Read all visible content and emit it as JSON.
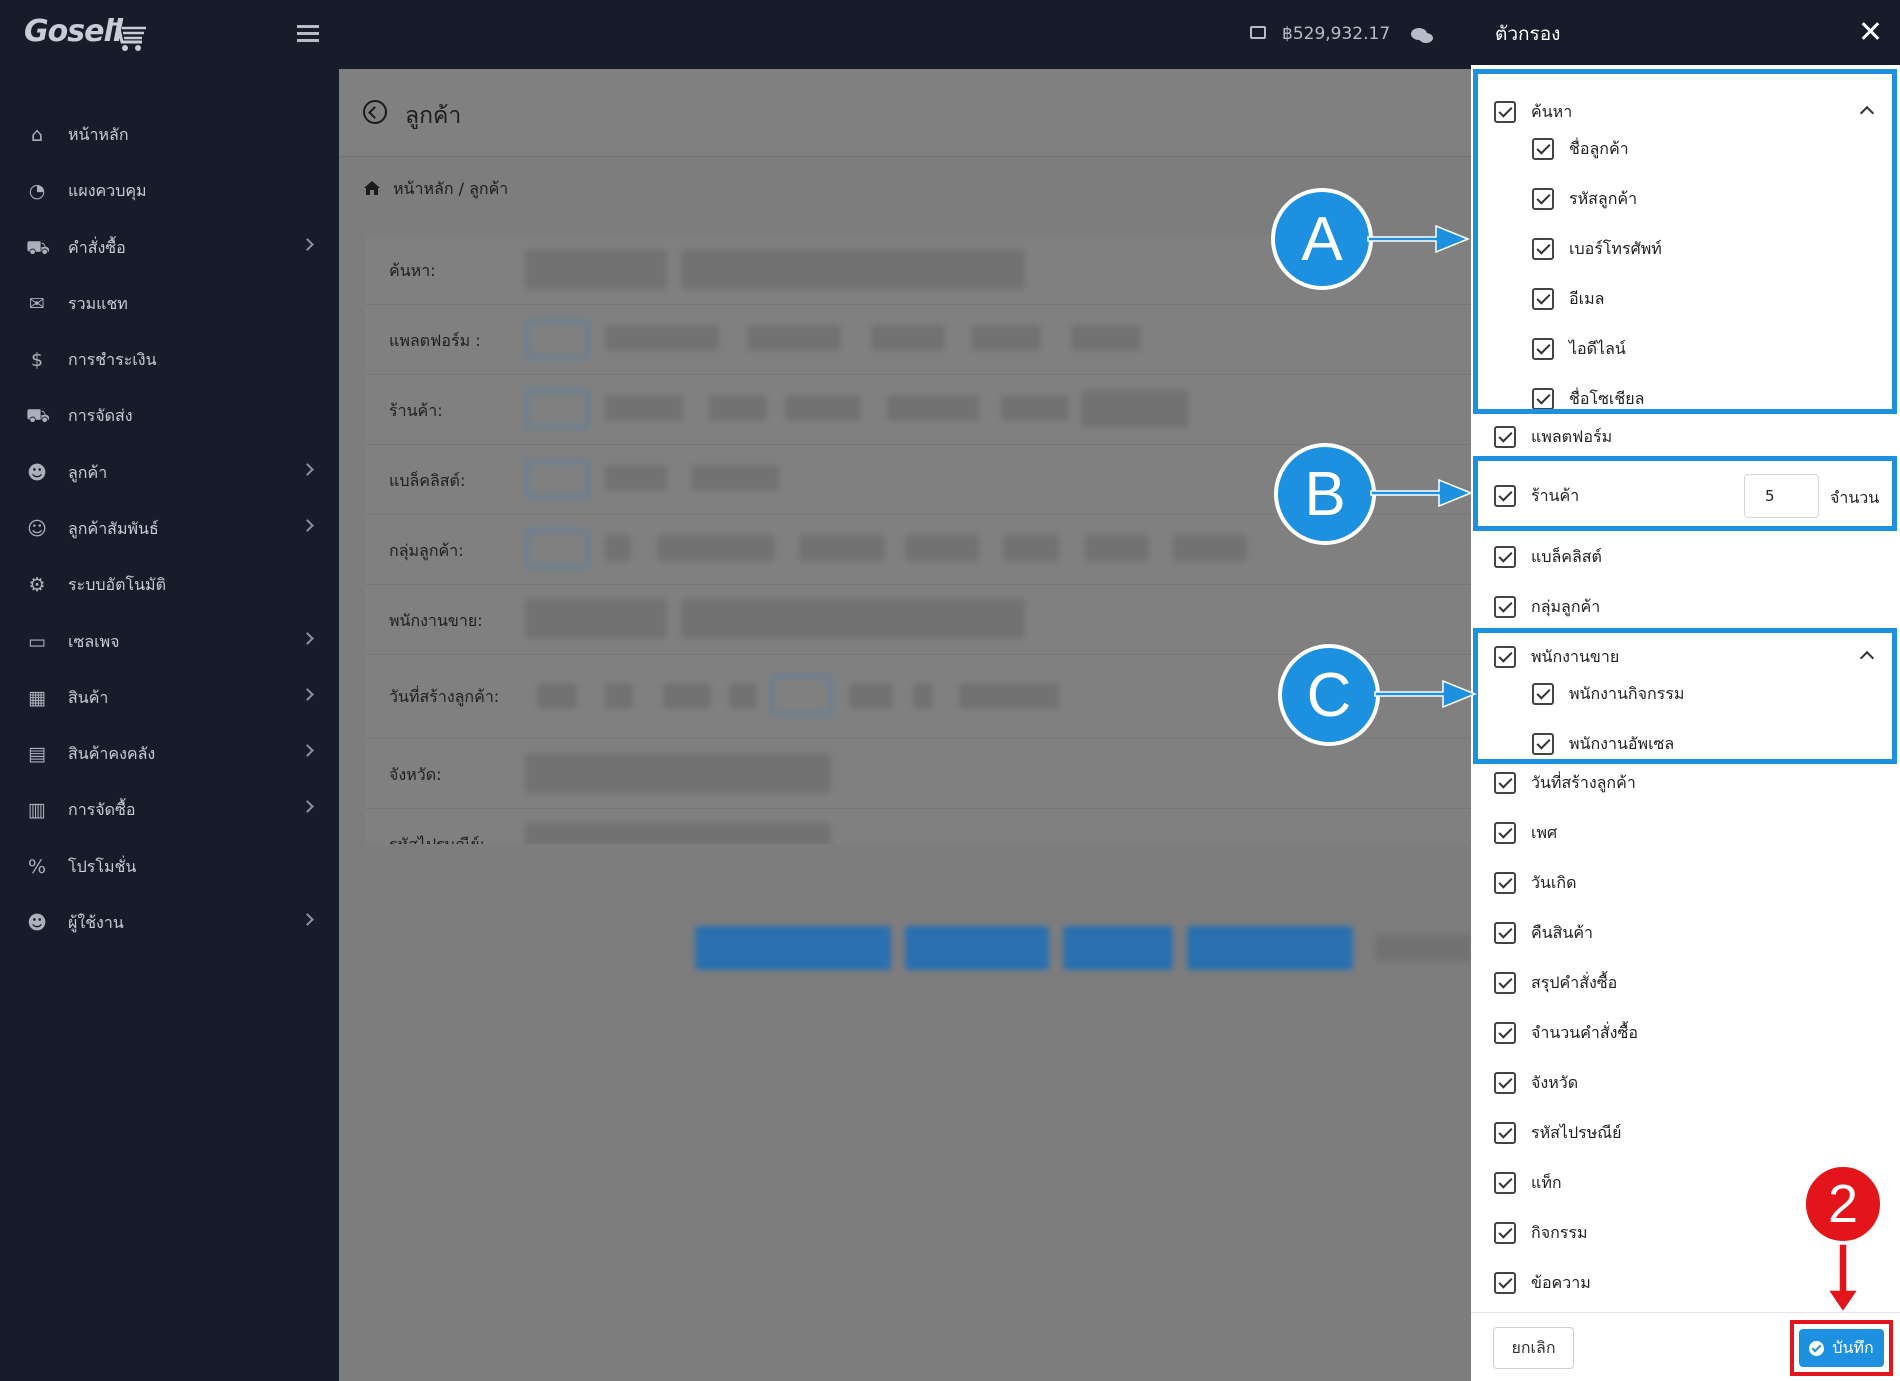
{
  "app": {
    "logo_text": "Gosell",
    "balance": "฿529,932.17"
  },
  "sidebar": {
    "items": [
      {
        "label": "หน้าหลัก",
        "icon": "home-icon",
        "glyph": "⌂",
        "has_children": false
      },
      {
        "label": "แผงควบคุม",
        "icon": "dashboard-icon",
        "glyph": "◔",
        "has_children": false
      },
      {
        "label": "คำสั่งซื้อ",
        "icon": "cart-icon",
        "glyph": "⛟",
        "has_children": true
      },
      {
        "label": "รวมแชท",
        "icon": "chat-icon",
        "glyph": "✉",
        "has_children": false
      },
      {
        "label": "การชำระเงิน",
        "icon": "money-bag-icon",
        "glyph": "$",
        "has_children": false
      },
      {
        "label": "การจัดส่ง",
        "icon": "truck-icon",
        "glyph": "⛟",
        "has_children": false
      },
      {
        "label": "ลูกค้า",
        "icon": "users-icon",
        "glyph": "☻",
        "has_children": true
      },
      {
        "label": "ลูกค้าสัมพันธ์",
        "icon": "user-tie-icon",
        "glyph": "☺",
        "has_children": true
      },
      {
        "label": "ระบบอัตโนมัติ",
        "icon": "robot-icon",
        "glyph": "⚙",
        "has_children": false
      },
      {
        "label": "เซลเพจ",
        "icon": "window-icon",
        "glyph": "▭",
        "has_children": true
      },
      {
        "label": "สินค้า",
        "icon": "boxes-icon",
        "glyph": "▦",
        "has_children": true
      },
      {
        "label": "สินค้าคงคลัง",
        "icon": "warehouse-icon",
        "glyph": "▤",
        "has_children": true
      },
      {
        "label": "การจัดซื้อ",
        "icon": "dolly-icon",
        "glyph": "▥",
        "has_children": true
      },
      {
        "label": "โปรโมชั่น",
        "icon": "percent-icon",
        "glyph": "%",
        "has_children": false
      },
      {
        "label": "ผู้ใช้งาน",
        "icon": "users-cog-icon",
        "glyph": "☻",
        "has_children": true
      }
    ]
  },
  "main": {
    "title": "ลูกค้า",
    "breadcrumb": "หน้าหลัก / ลูกค้า",
    "filter_labels": [
      "ค้นหา:",
      "แพลตฟอร์ม :",
      "ร้านค้า:",
      "แบล็คลิสต์:",
      "กลุ่มลูกค้า:",
      "พนักงานขาย:",
      "วันที่สร้างลูกค้า:",
      "จังหวัด:",
      "รหัสไปรษณีย์:"
    ]
  },
  "panel": {
    "title": "ตัวกรอง",
    "search_group": {
      "label": "ค้นหา",
      "children": [
        "ชื่อลูกค้า",
        "รหัสลูกค้า",
        "เบอร์โทรศัพท์",
        "อีเมล",
        "ไอดีไลน์",
        "ชื่อโซเชียล"
      ]
    },
    "platform_label": "แพลตฟอร์ม",
    "store": {
      "label": "ร้านค้า",
      "count": "5",
      "unit": "จำนวน"
    },
    "blacklist_label": "แบล็คลิสต์",
    "customer_group_label": "กลุ่มลูกค้า",
    "sales_group": {
      "label": "พนักงานขาย",
      "children": [
        "พนักงานกิจกรรม",
        "พนักงานอัพเซล"
      ]
    },
    "rest": [
      "วันที่สร้างลูกค้า",
      "เพศ",
      "วันเกิด",
      "คืนสินค้า",
      "สรุปคำสั่งซื้อ",
      "จำนวนคำสั่งซื้อ",
      "จังหวัด",
      "รหัสไปรษณีย์",
      "แท็ก",
      "กิจกรรม",
      "ข้อความ"
    ],
    "cancel_label": "ยกเลิก",
    "save_label": "บันทึก"
  },
  "annotations": {
    "a": "A",
    "b": "B",
    "c": "C",
    "step": "2",
    "color": "#1d90e0",
    "step_color": "#e3151a"
  }
}
